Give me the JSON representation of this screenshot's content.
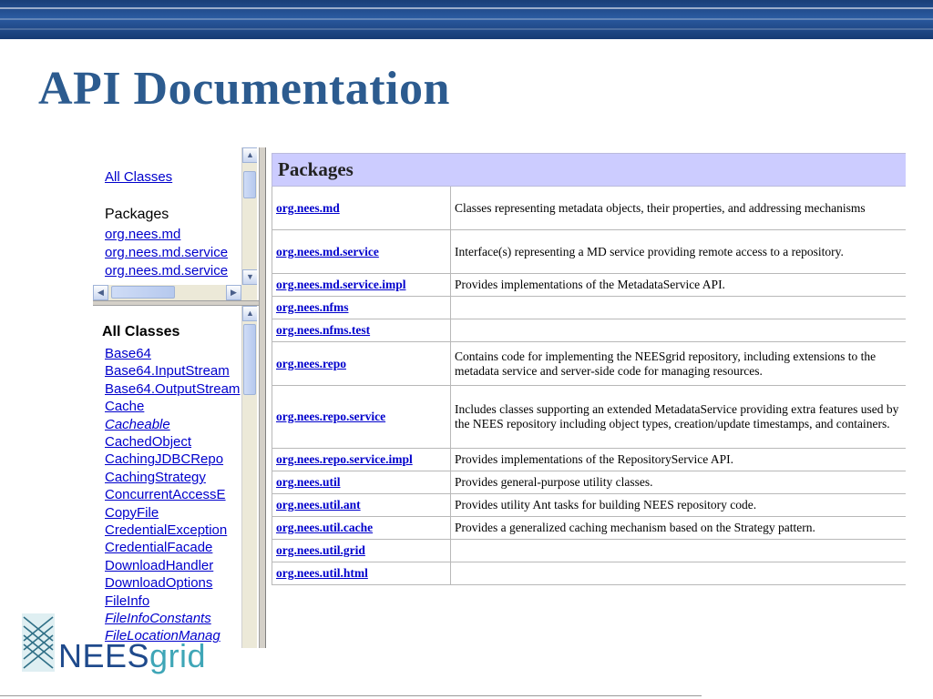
{
  "slide": {
    "title": "API Documentation"
  },
  "colors": {
    "banner": "#1f4a8c",
    "title": "#2c5b8f",
    "link": "#0000cc",
    "table_header": "#ccccff",
    "logo_nees": "#1f4a8c",
    "logo_grid": "#3fa6b7"
  },
  "overview_frame": {
    "all_classes_link": "All Classes",
    "packages_heading": "Packages",
    "packages": [
      "org.nees.md",
      "org.nees.md.service",
      "org.nees.md.service"
    ]
  },
  "classes_frame": {
    "heading": "All Classes",
    "classes": [
      {
        "name": "Base64",
        "italic": false
      },
      {
        "name": "Base64.InputStream",
        "italic": false
      },
      {
        "name": "Base64.OutputStream",
        "italic": false
      },
      {
        "name": "Cache",
        "italic": false
      },
      {
        "name": "Cacheable",
        "italic": true
      },
      {
        "name": "CachedObject",
        "italic": false
      },
      {
        "name": "CachingJDBCRepo",
        "italic": false
      },
      {
        "name": "CachingStrategy",
        "italic": false
      },
      {
        "name": "ConcurrentAccessE",
        "italic": false
      },
      {
        "name": "CopyFile",
        "italic": false
      },
      {
        "name": "CredentialException",
        "italic": false
      },
      {
        "name": "CredentialFacade",
        "italic": false
      },
      {
        "name": "DownloadHandler",
        "italic": false
      },
      {
        "name": "DownloadOptions",
        "italic": false
      },
      {
        "name": "FileInfo",
        "italic": false
      },
      {
        "name": "FileInfoConstants",
        "italic": true
      },
      {
        "name": "FileLocationManag",
        "italic": true
      }
    ]
  },
  "packages_table": {
    "header": "Packages",
    "rows": [
      {
        "name": "org.nees.md",
        "desc": "Classes representing metadata objects, their properties, and addressing mechanisms"
      },
      {
        "name": "org.nees.md.service",
        "desc": "Interface(s) representing a MD service providing remote access to a repository."
      },
      {
        "name": "org.nees.md.service.impl",
        "desc": "Provides implementations of the MetadataService API."
      },
      {
        "name": "org.nees.nfms",
        "desc": ""
      },
      {
        "name": "org.nees.nfms.test",
        "desc": ""
      },
      {
        "name": "org.nees.repo",
        "desc": "Contains code for implementing the NEESgrid repository, including extensions to the metadata service and server-side code for managing resources."
      },
      {
        "name": "org.nees.repo.service",
        "desc": "Includes classes supporting an extended MetadataService providing extra features used by the NEES repository including object types, creation/update timestamps, and containers."
      },
      {
        "name": "org.nees.repo.service.impl",
        "desc": "Provides implementations of the RepositoryService API."
      },
      {
        "name": "org.nees.util",
        "desc": "Provides general-purpose utility classes."
      },
      {
        "name": "org.nees.util.ant",
        "desc": "Provides utility Ant tasks for building NEES repository code."
      },
      {
        "name": "org.nees.util.cache",
        "desc": "Provides a generalized caching mechanism based on the Strategy pattern."
      },
      {
        "name": "org.nees.util.grid",
        "desc": ""
      },
      {
        "name": "org.nees.util.html",
        "desc": ""
      }
    ]
  },
  "logo": {
    "part1": "NEES",
    "part2": "grid"
  },
  "icons": {
    "scroll_up": "▲",
    "scroll_down": "▼",
    "scroll_left": "◀",
    "scroll_right": "▶"
  }
}
